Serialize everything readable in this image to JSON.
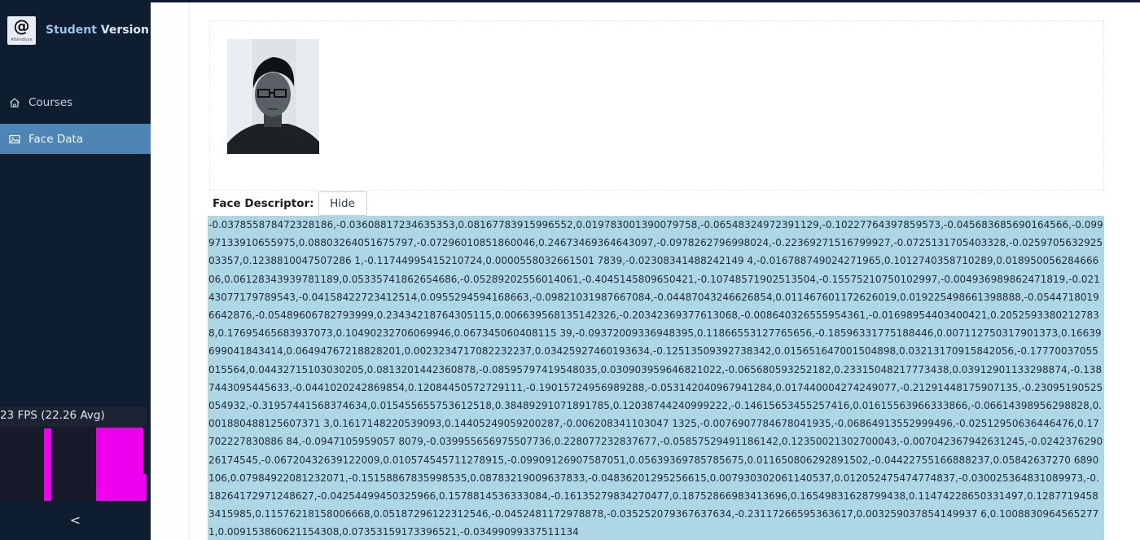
{
  "sidebar": {
    "brand": {
      "logo_symbol": "@",
      "logo_sub": "Attendlyze",
      "title_part1": "Student",
      "title_part2": "Version"
    },
    "nav": [
      {
        "label": "Courses",
        "icon": "home-icon",
        "active": false
      },
      {
        "label": "Face Data",
        "icon": "image-icon",
        "active": true
      }
    ],
    "fps": {
      "text": "23 FPS (22.26 Avg)",
      "bar_color": "#ee00ee"
    },
    "collapse_label": "<"
  },
  "main": {
    "photo_alt": "Student face photo",
    "descriptor": {
      "label": "Face Descriptor:",
      "toggle_label": "Hide",
      "values": "-0.037855878472328186,-0.03608817234635353,0.08167783915996552,0.019783001390079758,-0.06548324972391129,-0.10227764397859573,-0.045683685690164566,-0.09997133910655975,0.08803264051675797,-0.07296010851860046,0.24673469364643097,-0.0978262796998024,-0.22369271516799927,-0.0725131705403328,-0.025970563292503357,0.1238810047507286 1,-0.11744995415210724,0.0000558032661501 7839,-0.02308341488242149 4,-0.016788749024271965,0.1012740358710289,0.01895005628466606,0.06128343939781189,0.05335741862654686,-0.05289202556014061,-0.4045145809650421,-0.10748571902513504,-0.15575210750102997,-0.004936989862471819,-0.02143077179789543,-0.04158422723412514,0.0955294594168663,-0.09821031987667084,-0.04487043246626854,0.011467601172626019,0.019225498661398888,-0.05447180196642876,-0.05489606782793999,0.23434218764305115,0.006639568135142326,-0.20342369377613068,-0.008640326555954361,-0.01698954403400421,0.20525933802127838,0.17695465683937073,0.10490232706069946,0.067345060408115 39,-0.09372009336948395,0.11866553127765656,-0.18596331775188446,0.007112750317901373,0.16639699041843414,0.06494767218828201,0.0023234717082232237,0.03425927460193634,-0.12513509392738342,0.015651647001504898,0.03213170915842056,-0.17770037055015564,0.04432715103030205,0.0813201442360878,-0.08595797419548035,0.030903959646821022,-0.065680593252182,0.23315048217773438,0.03912901133298874,-0.1387443095445633,-0.0441020242869854,0.12084450572729111,-0.19015724956989288,-0.053142040967941284,0.017440004274249077,-0.21291448175907135,-0.23095190525054932,-0.31957441568374634,0.015455655753612518,0.38489291071891785,0.12038744240999222,-0.14615653455257416,0.01615563966333866,-0.06614398956298828,0.001880488125607371 3,0.1617148220539093,0.14405249059200287,-0.006208341103047 1325,-0.0076907784678041935,-0.06864913552999496,-0.02512950636446476,0.17702227830886 84,-0.0947105959057 8079,-0.039955656975507736,0.228077232837677,-0.05857529491186142,0.12350021302700043,-0.007042367942631245,-0.024237629026174545,-0.06720432639122009,0.010574545711278915,-0.09909126907587051,0.05639369785785675,0.011650806292891502,-0.04422755166888237,0.05842637270 6890106,0.07984922081232071,-0.15158867835998535,0.08783219009637833,-0.04836201295256615,0.007930302061140537,0.012052475474774837,-0.030025364831089973,-0.18264172971248627,-0.04254499450325966,0.1578814536333084,-0.16135279834270477,0.18752866983413696,0.16549831628799438,0.11474228650331497,0.12877194583415985,0.11576218158006668,0.05187296122312546,-0.0452481172978878,-0.035252079367637634,-0.23117266595363617,0.003259037854149937 6,0.10088309645652771,0.009153860621154308,0.07353159173396521,-0.03499099337511134"
    }
  }
}
